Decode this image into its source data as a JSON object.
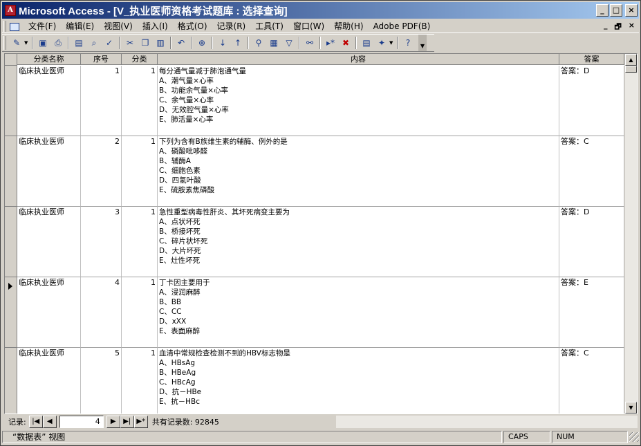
{
  "window": {
    "title": "Microsoft Access - [V_执业医师资格考试题库 : 选择查询]",
    "controls": [
      "_",
      "□",
      "×"
    ]
  },
  "menu": {
    "items": [
      "文件(F)",
      "编辑(E)",
      "视图(V)",
      "插入(I)",
      "格式(O)",
      "记录(R)",
      "工具(T)",
      "窗口(W)",
      "帮助(H)",
      "Adobe PDF(B)"
    ],
    "mdi_controls": [
      "_",
      "🗗",
      "×"
    ]
  },
  "toolbar": {
    "icons": [
      "design-view-icon",
      "save-icon",
      "print-preview-icon",
      "print-icon",
      "preview-icon",
      "spelling-icon",
      "cut-icon",
      "copy-icon",
      "paste-icon",
      "undo-icon",
      "hyperlink-icon",
      "sort-ascending-icon",
      "sort-descending-icon",
      "filter-by-selection-icon",
      "filter-by-form-icon",
      "apply-filter-icon",
      "find-icon",
      "new-record-icon",
      "delete-record-icon",
      "database-window-icon",
      "new-object-icon",
      "help-icon"
    ]
  },
  "table": {
    "columns": [
      "分类名称",
      "序号",
      "分类",
      "内容",
      "答案"
    ],
    "current_row": 3,
    "rows": [
      {
        "category": "临床执业医师",
        "seq": "1",
        "type": "1",
        "content": "每分通气量减于肺泡通气量\nA、潮气量×心率\nB、功能余气量×心率\nC、余气量×心率\nD、无效腔气量×心率\nE、肺活量×心率",
        "answer": "答案：D"
      },
      {
        "category": "临床执业医师",
        "seq": "2",
        "type": "1",
        "content": "下列为含有B族维生素的辅酶、例外的是\nA、磷酸吡哆醛\nB、辅酶A\nC、细胞色素\nD、四氢叶酸\nE、硫胺素焦磷酸",
        "answer": "答案：C"
      },
      {
        "category": "临床执业医师",
        "seq": "3",
        "type": "1",
        "content": "急性重型病毒性肝炎、其坏死病变主要为\nA、点状坏死\nB、桥接坏死\nC、碎片状坏死\nD、大片坏死\nE、灶性坏死",
        "answer": "答案：D"
      },
      {
        "category": "临床执业医师",
        "seq": "4",
        "type": "1",
        "content": "丁卡因主要用于\nA、浸润麻醉\nB、BB\nC、CC\nD、xXX\nE、表面麻醉",
        "answer": "答案：E"
      },
      {
        "category": "临床执业医师",
        "seq": "5",
        "type": "1",
        "content": "血清中常规检查检测不到的HBV标志物是\nA、HBsAg\nB、HBeAg\nC、HBcAg\nD、抗－HBe\nE、抗－HBc",
        "answer": "答案：C"
      }
    ]
  },
  "navigation": {
    "label": "记录:",
    "current": "4",
    "total_text": "共有记录数: 92845",
    "buttons": [
      "|◀",
      "◀",
      "▶",
      "▶|",
      "▶*"
    ]
  },
  "status": {
    "view": "“数据表” 视图",
    "caps": "CAPS",
    "num": "NUM"
  }
}
